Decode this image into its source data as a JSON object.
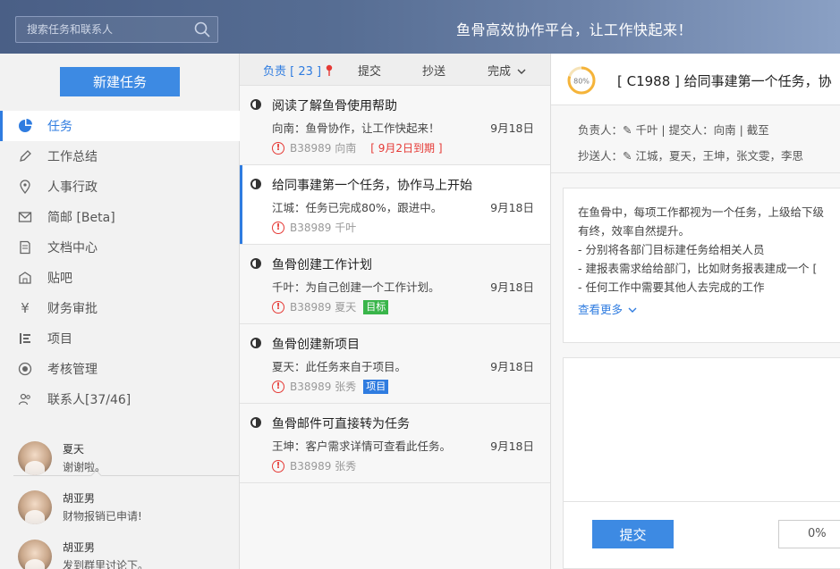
{
  "header": {
    "search_placeholder": "搜索任务和联系人",
    "slogan": "鱼骨高效协作平台，让工作快起来！"
  },
  "sidebar": {
    "new_task_label": "新建任务",
    "items": [
      {
        "label": "任务",
        "icon": "pie-chart-icon",
        "active": true
      },
      {
        "label": "工作总结",
        "icon": "pencil-icon"
      },
      {
        "label": "人事行政",
        "icon": "location-pin-icon"
      },
      {
        "label": "简邮 [Beta]",
        "icon": "envelope-icon"
      },
      {
        "label": "文档中心",
        "icon": "document-icon"
      },
      {
        "label": "贴吧",
        "icon": "building-icon"
      },
      {
        "label": "财务审批",
        "icon": "yen-icon"
      },
      {
        "label": "项目",
        "icon": "list-icon"
      },
      {
        "label": "考核管理",
        "icon": "target-icon"
      },
      {
        "label": "联系人[37/46]",
        "icon": "contacts-icon"
      }
    ],
    "contacts": [
      {
        "name": "夏天",
        "message": "谢谢啦。"
      },
      {
        "name": "胡亚男",
        "message": "财物报销已申请!"
      },
      {
        "name": "胡亚男",
        "message": "发到群里讨论下。"
      }
    ]
  },
  "tasklist": {
    "tabs": {
      "responsible": "负责 [ 23 ]",
      "submitted": "提交",
      "cc": "抄送",
      "done": "完成"
    },
    "items": [
      {
        "title": "阅读了解鱼骨使用帮助",
        "subtitle": "向南：鱼骨协作，让工作快起来！",
        "date": "9月18日",
        "meta": "B38989 向南",
        "due": "[ 9月2日到期 ]",
        "tag": ""
      },
      {
        "title": "给同事建第一个任务，协作马上开始",
        "subtitle": "江城：任务已完成80%，跟进中。",
        "date": "9月18日",
        "meta": "B38989 千叶",
        "due": "",
        "tag": "",
        "selected": true
      },
      {
        "title": "鱼骨创建工作计划",
        "subtitle": "千叶：为自己创建一个工作计划。",
        "date": "9月18日",
        "meta": "B38989 夏天",
        "due": "",
        "tag": "目标",
        "tag_color": "green"
      },
      {
        "title": "鱼骨创建新项目",
        "subtitle": "夏天：此任务来自于项目。",
        "date": "9月18日",
        "meta": "B38989 张秀",
        "due": "",
        "tag": "项目",
        "tag_color": "blue"
      },
      {
        "title": "鱼骨邮件可直接转为任务",
        "subtitle": "王坤：客户需求详情可查看此任务。",
        "date": "9月18日",
        "meta": "B38989 张秀",
        "due": "",
        "tag": ""
      }
    ]
  },
  "detail": {
    "progress_label": "80%",
    "progress": 0.8,
    "title": "[ C1988 ]  给同事建第一个任务，协",
    "owner_line": "负责人：✎ 千叶   |   提交人：向南   |   截至",
    "cc_line": "抄送人：✎ 江城，夏天，王坤，张文雯，李思",
    "description": [
      "在鱼骨中，每项工作都视为一个任务，上级给下级",
      "有终，效率自然提升。",
      "- 分别将各部门目标建任务给相关人员",
      "- 建报表需求给给部门，比如财务报表建成一个 [",
      "- 任何工作中需要其他人去完成的工作"
    ],
    "see_more": "查看更多",
    "submit_label": "提交",
    "percent_value": "0%"
  },
  "colors": {
    "accent": "#2f7ce0",
    "warning": "#e53935",
    "tag_green": "#39b54a"
  }
}
